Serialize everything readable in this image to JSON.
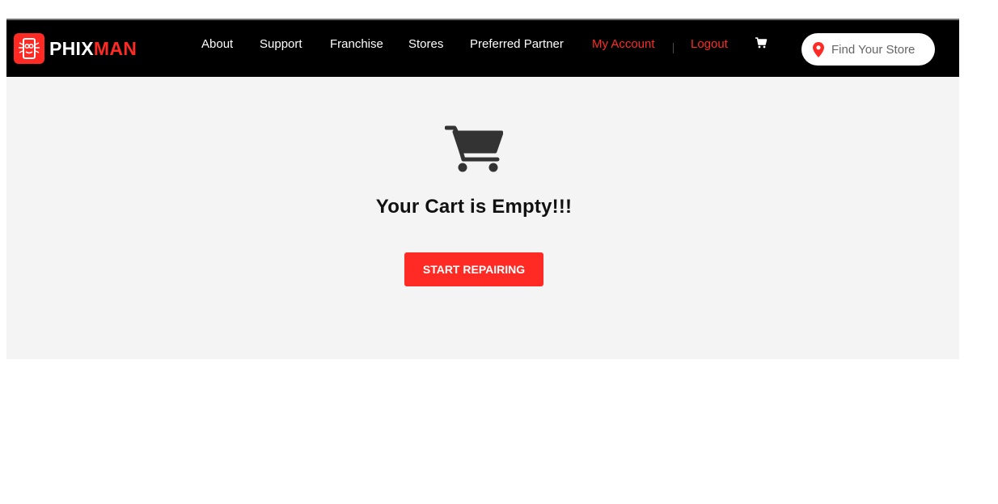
{
  "brand": {
    "logo_part1": "PHIX",
    "logo_part2": "MAN",
    "accent_color": "#ff2a24",
    "logo_icon": "phixman-logo-icon"
  },
  "nav": {
    "items": [
      {
        "label": "About"
      },
      {
        "label": "Support"
      },
      {
        "label": "Franchise"
      },
      {
        "label": "Stores"
      },
      {
        "label": "Preferred Partner"
      },
      {
        "label": "My Account"
      },
      {
        "label": "Logout"
      }
    ],
    "cart_icon": "cart-icon"
  },
  "search": {
    "placeholder": "Find Your Store",
    "icon": "map-pin-icon"
  },
  "cart": {
    "icon": "shopping-cart-icon",
    "empty_message": "Your Cart is Empty!!!",
    "cta_label": "START REPAIRING"
  }
}
